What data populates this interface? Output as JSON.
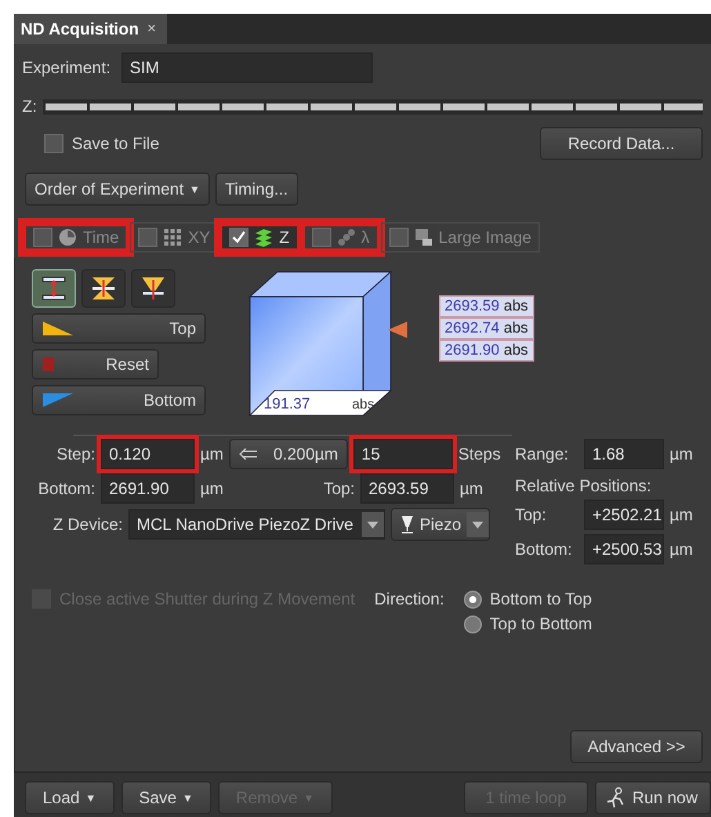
{
  "tab": {
    "title": "ND Acquisition",
    "close": "×"
  },
  "experiment": {
    "label": "Experiment:",
    "value": "SIM"
  },
  "z_bar": {
    "label": "Z:"
  },
  "save_to_file": {
    "label": "Save to File",
    "checked": false
  },
  "record_button": "Record Data...",
  "order_button": {
    "label": "Order of Experiment",
    "caret": "▼"
  },
  "timing_button": "Timing...",
  "dimension_tabs": [
    {
      "kind": "time",
      "label": "Time",
      "checked": false,
      "selected": false,
      "highlighted": true
    },
    {
      "kind": "xy",
      "label": "XY",
      "checked": false,
      "selected": false,
      "highlighted": false
    },
    {
      "kind": "z",
      "label": "Z",
      "checked": true,
      "selected": true,
      "highlighted": true
    },
    {
      "kind": "lambda",
      "label": "λ",
      "checked": false,
      "selected": false,
      "highlighted": true
    },
    {
      "kind": "large",
      "label": "Large Image",
      "checked": false,
      "selected": false,
      "highlighted": false
    }
  ],
  "z_panel": {
    "modes": [
      {
        "kind": "range",
        "selected": true
      },
      {
        "kind": "symmetric",
        "selected": false
      },
      {
        "kind": "asymmetric",
        "selected": false
      }
    ],
    "top_button": "Top",
    "reset_button": "Reset",
    "bottom_button": "Bottom",
    "positions": [
      {
        "value": "2693.59",
        "unit": "abs"
      },
      {
        "value": "2692.74",
        "unit": "abs"
      },
      {
        "value": "2691.90",
        "unit": "abs"
      }
    ],
    "range_value": "191.37",
    "range_unit": "abs"
  },
  "step": {
    "label": "Step:",
    "value": "0.120",
    "unit": "µm",
    "highlighted": true
  },
  "suggested": {
    "value": "0.200µm"
  },
  "steps": {
    "value": "15",
    "label": "Steps",
    "highlighted": true
  },
  "bottom": {
    "label": "Bottom:",
    "value": "2691.90",
    "unit": "µm"
  },
  "top": {
    "label": "Top:",
    "value": "2693.59",
    "unit": "µm"
  },
  "z_device": {
    "label": "Z Device:",
    "value": "MCL NanoDrive PiezoZ Drive",
    "mode": "Piezo"
  },
  "range": {
    "label": "Range:",
    "value": "1.68",
    "unit": "µm"
  },
  "relative": {
    "title": "Relative Positions:",
    "rows": [
      {
        "label": "Top:",
        "value": "+2502.21",
        "unit": "µm"
      },
      {
        "label": "Bottom:",
        "value": "+2500.53",
        "unit": "µm"
      }
    ]
  },
  "shutter": {
    "label": "Close active Shutter during Z Movement",
    "checked": false,
    "disabled": true
  },
  "direction": {
    "label": "Direction:",
    "options": [
      {
        "label": "Bottom to Top",
        "selected": true
      },
      {
        "label": "Top to Bottom",
        "selected": false
      }
    ]
  },
  "advanced_button": "Advanced >>",
  "footer": [
    {
      "kind": "menu",
      "label": "Load",
      "caret": "▼",
      "disabled": false
    },
    {
      "kind": "menu",
      "label": "Save",
      "caret": "▼",
      "disabled": false
    },
    {
      "kind": "menu",
      "label": "Remove",
      "caret": "▼",
      "disabled": true
    },
    {
      "kind": "plain",
      "label": "1 time loop",
      "disabled": true
    },
    {
      "kind": "run",
      "label": "Run now",
      "disabled": false
    }
  ]
}
